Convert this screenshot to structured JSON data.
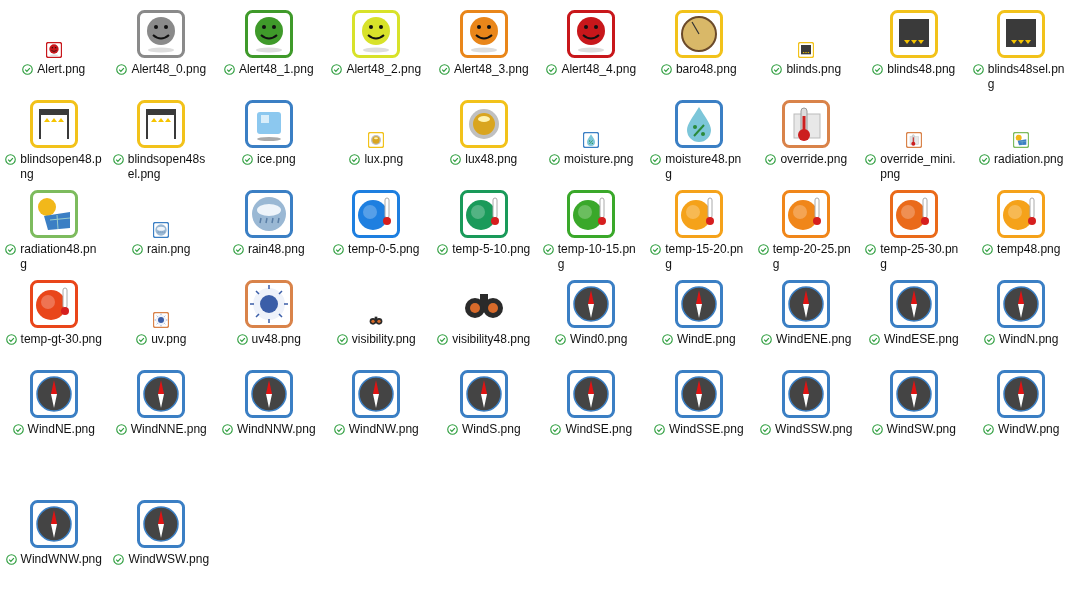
{
  "files": [
    {
      "name": "Alert.png",
      "synced": true,
      "kind": "small",
      "thumbnail": {
        "kind": "smiley",
        "color": "#c8171b"
      }
    },
    {
      "name": "Alert48_0.png",
      "synced": true,
      "kind": "large",
      "thumbnail": {
        "kind": "smiley",
        "color": "#8a8a8a"
      }
    },
    {
      "name": "Alert48_1.png",
      "synced": true,
      "kind": "large",
      "thumbnail": {
        "kind": "smiley",
        "color": "#3f9a2a"
      }
    },
    {
      "name": "Alert48_2.png",
      "synced": true,
      "kind": "large",
      "thumbnail": {
        "kind": "smiley",
        "color": "#d8e22a"
      }
    },
    {
      "name": "Alert48_3.png",
      "synced": true,
      "kind": "large",
      "thumbnail": {
        "kind": "smiley",
        "color": "#e9861a"
      }
    },
    {
      "name": "Alert48_4.png",
      "synced": true,
      "kind": "large",
      "thumbnail": {
        "kind": "smiley",
        "color": "#c8171b"
      }
    },
    {
      "name": "baro48.png",
      "synced": true,
      "kind": "large",
      "thumbnail": {
        "kind": "gauge",
        "color": "#d9b868"
      }
    },
    {
      "name": "blinds.png",
      "synced": true,
      "kind": "small",
      "thumbnail": {
        "kind": "blinds-down",
        "color": "#3a3a3a"
      }
    },
    {
      "name": "blinds48.png",
      "synced": true,
      "kind": "large",
      "thumbnail": {
        "kind": "blinds-down",
        "color": "#3a3a3a"
      }
    },
    {
      "name": "blinds48sel.png",
      "synced": true,
      "kind": "large",
      "thumbnail": {
        "kind": "blinds-down",
        "color": "#3a3a3a"
      }
    },
    {
      "name": "blindsopen48.png",
      "synced": true,
      "kind": "large",
      "thumbnail": {
        "kind": "blinds-up",
        "color": "#3a3a3a"
      }
    },
    {
      "name": "blindsopen48sel.png",
      "synced": true,
      "kind": "large",
      "thumbnail": {
        "kind": "blinds-up",
        "color": "#3a3a3a"
      }
    },
    {
      "name": "ice.png",
      "synced": true,
      "kind": "large",
      "thumbnail": {
        "kind": "ice",
        "color": "#8cc8ef"
      }
    },
    {
      "name": "lux.png",
      "synced": true,
      "kind": "small",
      "thumbnail": {
        "kind": "lux",
        "color": "#d9a520"
      }
    },
    {
      "name": "lux48.png",
      "synced": true,
      "kind": "large",
      "thumbnail": {
        "kind": "lux",
        "color": "#d9a520"
      }
    },
    {
      "name": "moisture.png",
      "synced": true,
      "kind": "small",
      "thumbnail": {
        "kind": "drop",
        "color": "#7cc6d9"
      }
    },
    {
      "name": "moisture48.png",
      "synced": true,
      "kind": "large",
      "thumbnail": {
        "kind": "drop",
        "color": "#7cc6d9"
      }
    },
    {
      "name": "override.png",
      "synced": true,
      "kind": "large",
      "thumbnail": {
        "kind": "radiator",
        "color": "#cc1f1f"
      }
    },
    {
      "name": "override_mini.png",
      "synced": true,
      "kind": "small",
      "thumbnail": {
        "kind": "radiator",
        "color": "#cc1f1f"
      }
    },
    {
      "name": "radiation.png",
      "synced": true,
      "kind": "small",
      "thumbnail": {
        "kind": "solar",
        "color": "#f2b81a"
      }
    },
    {
      "name": "radiation48.png",
      "synced": true,
      "kind": "large",
      "thumbnail": {
        "kind": "solar",
        "color": "#f2b81a"
      }
    },
    {
      "name": "rain.png",
      "synced": true,
      "kind": "small",
      "thumbnail": {
        "kind": "rain",
        "color": "#9ab8d4"
      }
    },
    {
      "name": "rain48.png",
      "synced": true,
      "kind": "large",
      "thumbnail": {
        "kind": "rain",
        "color": "#9ab8d4"
      }
    },
    {
      "name": "temp-0-5.png",
      "synced": true,
      "kind": "large",
      "thumbnail": {
        "kind": "thermo",
        "color": "#1e7fe0"
      }
    },
    {
      "name": "temp-5-10.png",
      "synced": true,
      "kind": "large",
      "thumbnail": {
        "kind": "thermo",
        "color": "#1a9a5a"
      }
    },
    {
      "name": "temp-10-15.png",
      "synced": true,
      "kind": "large",
      "thumbnail": {
        "kind": "thermo",
        "color": "#3aa82a"
      }
    },
    {
      "name": "temp-15-20.png",
      "synced": true,
      "kind": "large",
      "thumbnail": {
        "kind": "thermo",
        "color": "#f5a21a"
      }
    },
    {
      "name": "temp-20-25.png",
      "synced": true,
      "kind": "large",
      "thumbnail": {
        "kind": "thermo",
        "color": "#f0861a"
      }
    },
    {
      "name": "temp-25-30.png",
      "synced": true,
      "kind": "large",
      "thumbnail": {
        "kind": "thermo",
        "color": "#ea6a1a"
      }
    },
    {
      "name": "temp48.png",
      "synced": true,
      "kind": "large",
      "thumbnail": {
        "kind": "thermo",
        "color": "#f5a21a"
      }
    },
    {
      "name": "temp-gt-30.png",
      "synced": true,
      "kind": "large",
      "thumbnail": {
        "kind": "thermo",
        "color": "#e9461a"
      }
    },
    {
      "name": "uv.png",
      "synced": true,
      "kind": "small",
      "thumbnail": {
        "kind": "uv",
        "color": "#3b5ea8"
      }
    },
    {
      "name": "uv48.png",
      "synced": true,
      "kind": "large",
      "thumbnail": {
        "kind": "uv",
        "color": "#3b5ea8"
      }
    },
    {
      "name": "visibility.png",
      "synced": true,
      "kind": "small",
      "thumbnail": {
        "kind": "binoculars",
        "color": "#2a2a2a"
      }
    },
    {
      "name": "visibility48.png",
      "synced": true,
      "kind": "large",
      "thumbnail": {
        "kind": "binoculars",
        "color": "#2a2a2a"
      }
    },
    {
      "name": "Wind0.png",
      "synced": true,
      "kind": "large",
      "thumbnail": {
        "kind": "compass",
        "color": "#444444"
      }
    },
    {
      "name": "WindE.png",
      "synced": true,
      "kind": "large",
      "thumbnail": {
        "kind": "compass",
        "color": "#444444"
      }
    },
    {
      "name": "WindENE.png",
      "synced": true,
      "kind": "large",
      "thumbnail": {
        "kind": "compass",
        "color": "#444444"
      }
    },
    {
      "name": "WindESE.png",
      "synced": true,
      "kind": "large",
      "thumbnail": {
        "kind": "compass",
        "color": "#444444"
      }
    },
    {
      "name": "WindN.png",
      "synced": true,
      "kind": "large",
      "thumbnail": {
        "kind": "compass",
        "color": "#444444"
      }
    },
    {
      "name": "WindNE.png",
      "synced": true,
      "kind": "large",
      "thumbnail": {
        "kind": "compass",
        "color": "#444444"
      }
    },
    {
      "name": "WindNNE.png",
      "synced": true,
      "kind": "large",
      "thumbnail": {
        "kind": "compass",
        "color": "#444444"
      }
    },
    {
      "name": "WindNNW.png",
      "synced": true,
      "kind": "large",
      "thumbnail": {
        "kind": "compass",
        "color": "#444444"
      }
    },
    {
      "name": "WindNW.png",
      "synced": true,
      "kind": "large",
      "thumbnail": {
        "kind": "compass",
        "color": "#444444"
      }
    },
    {
      "name": "WindS.png",
      "synced": true,
      "kind": "large",
      "thumbnail": {
        "kind": "compass",
        "color": "#444444"
      }
    },
    {
      "name": "WindSE.png",
      "synced": true,
      "kind": "large",
      "thumbnail": {
        "kind": "compass",
        "color": "#444444"
      }
    },
    {
      "name": "WindSSE.png",
      "synced": true,
      "kind": "large",
      "thumbnail": {
        "kind": "compass",
        "color": "#444444"
      }
    },
    {
      "name": "WindSSW.png",
      "synced": true,
      "kind": "large",
      "thumbnail": {
        "kind": "compass",
        "color": "#444444"
      }
    },
    {
      "name": "WindSW.png",
      "synced": true,
      "kind": "large",
      "thumbnail": {
        "kind": "compass",
        "color": "#444444"
      }
    },
    {
      "name": "WindW.png",
      "synced": true,
      "kind": "large",
      "thumbnail": {
        "kind": "compass",
        "color": "#444444"
      }
    },
    {
      "name": "WindWNW.png",
      "synced": true,
      "kind": "large",
      "thumbnail": {
        "kind": "compass",
        "color": "#444444"
      }
    },
    {
      "name": "WindWSW.png",
      "synced": true,
      "kind": "large",
      "thumbnail": {
        "kind": "compass",
        "color": "#444444"
      }
    }
  ]
}
